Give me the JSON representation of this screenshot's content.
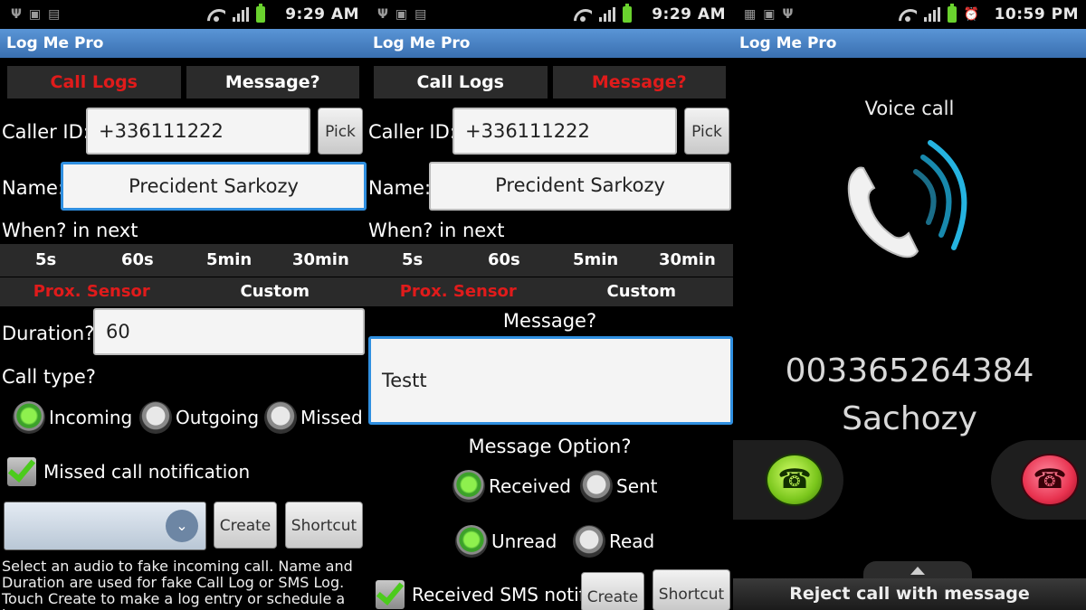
{
  "status": {
    "s1_time": "9:29 AM",
    "s2_time": "9:29 AM",
    "s3_time": "10:59 PM"
  },
  "app_title": "Log Me Pro",
  "tabs": {
    "call_logs": "Call Logs",
    "message": "Message?"
  },
  "form": {
    "caller_id_label": "Caller ID:",
    "caller_id_value": "+336111222",
    "pick_label": "Pick",
    "name_label": "Name:",
    "name_value": "Precident Sarkozy",
    "when_label": "When? in next",
    "presets": [
      "5s",
      "60s",
      "5min",
      "30min"
    ],
    "prox_sensor": "Prox. Sensor",
    "custom": "Custom",
    "duration_label": "Duration?",
    "duration_value": "60",
    "call_type_label": "Call type?",
    "call_types": [
      "Incoming",
      "Outgoing",
      "Missed"
    ],
    "call_type_selected": "Incoming",
    "missed_notification": "Missed call notification",
    "create": "Create",
    "shortcut": "Shortcut",
    "help_text": "Select an audio to fake incoming call. Name and Duration are used for fake Call Log or SMS Log. Touch Create to make a log entry or schedule a log"
  },
  "message_form": {
    "message_label": "Message?",
    "message_value": "Testt",
    "option_label": "Message Option?",
    "received": "Received",
    "sent": "Sent",
    "unread": "Unread",
    "read": "Read",
    "received_sms_notif": "Received SMS notif",
    "create": "Create",
    "shortcut": "Shortcut"
  },
  "incoming_call": {
    "title": "Voice call",
    "number": "003365264384",
    "caller_name": "Sachozy",
    "reject_with_message": "Reject call with message"
  },
  "icons": [
    "usb-icon",
    "android-icon",
    "sd-card-icon",
    "wifi-icon",
    "signal-icon",
    "battery-icon",
    "alarm-icon",
    "phone-icon",
    "answer-icon",
    "reject-icon",
    "chevron-down-icon"
  ],
  "colors": {
    "accent_red": "#e01b1b",
    "title_blue": "#3a6fb0",
    "focus_blue": "#2f8fe0",
    "radio_green": "#4ccb1d"
  }
}
